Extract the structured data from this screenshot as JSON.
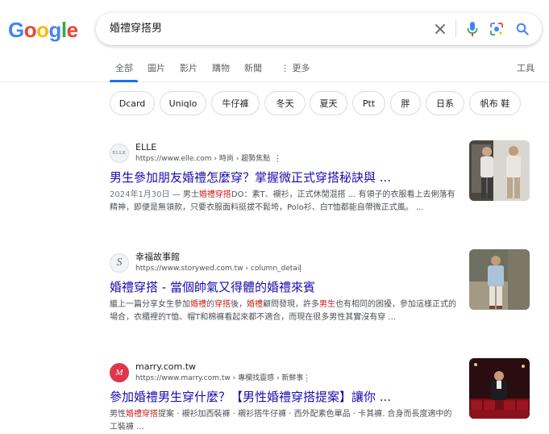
{
  "logo": {
    "letters": [
      "G",
      "o",
      "o",
      "g",
      "l",
      "e"
    ],
    "colors": [
      "#4285f4",
      "#ea4335",
      "#fbbc05",
      "#4285f4",
      "#34a853",
      "#ea4335"
    ]
  },
  "search": {
    "query": "婚禮穿搭男"
  },
  "tabs": [
    {
      "label": "全部",
      "active": true
    },
    {
      "label": "圖片",
      "active": false
    },
    {
      "label": "影片",
      "active": false
    },
    {
      "label": "購物",
      "active": false
    },
    {
      "label": "新聞",
      "active": false
    },
    {
      "label": "⋮ 更多",
      "active": false
    }
  ],
  "tools_label": "工具",
  "chips": [
    "Dcard",
    "Uniqlo",
    "牛仔褲",
    "冬天",
    "夏天",
    "Ptt",
    "胖",
    "日系",
    "帆布 鞋"
  ],
  "results": [
    {
      "site_name": "ELLE",
      "favicon_text": "ELLE",
      "url": "https://www.elle.com › 時尚 › 趨勢焦點",
      "title": "男生參加朋友婚禮怎麼穿？掌握微正式穿搭秘訣與 ...",
      "snippet": [
        {
          "text": "2024年1月30日",
          "style": "date"
        },
        {
          "text": " — 男士",
          "style": ""
        },
        {
          "text": "婚禮穿搭",
          "style": "hl"
        },
        {
          "text": "DO：素T、襯衫，正式休閒混搭 ... 有領子的衣服看上去俐落有精神，即便是無領款，只要衣服面料挺拔不鬆垮，Polo衫、白T恤都能自帶微正式風。 ...",
          "style": ""
        }
      ]
    },
    {
      "site_name": "幸福故事館",
      "favicon_text": "S",
      "url": "https://www.storywed.com.tw › column_detail",
      "title": "婚禮穿搭 - 當個帥氣又得體的婚禮來賓",
      "snippet": [
        {
          "text": "繼上一篇分享女生參加",
          "style": ""
        },
        {
          "text": "婚禮",
          "style": "hl"
        },
        {
          "text": "的",
          "style": ""
        },
        {
          "text": "穿搭",
          "style": "hl"
        },
        {
          "text": "後，",
          "style": ""
        },
        {
          "text": "婚禮",
          "style": "hl"
        },
        {
          "text": "顧問發現，許多",
          "style": ""
        },
        {
          "text": "男生",
          "style": "hl"
        },
        {
          "text": "也有相同的困擾，參加這樣正式的場合，衣櫃裡的T恤、帽T和棉褲看起來都不適合，而現在很多男性其實沒有穿 ...",
          "style": ""
        }
      ]
    },
    {
      "site_name": "marry.com.tw",
      "favicon_text": "M",
      "url": "https://www.marry.com.tw › 專欄找靈感 › 新鮮事",
      "title": "參加婚禮男生穿什麼？【男性婚禮穿搭提案】讓你 ...",
      "snippet": [
        {
          "text": "男性",
          "style": ""
        },
        {
          "text": "婚禮穿搭",
          "style": "hl"
        },
        {
          "text": "提案 · 襯衫加西裝褲 · 襯衫搭牛仔褲 · 西外配素色單品 · 卡其褲. 合身而長度適中的工裝褲 ...",
          "style": ""
        }
      ]
    }
  ]
}
